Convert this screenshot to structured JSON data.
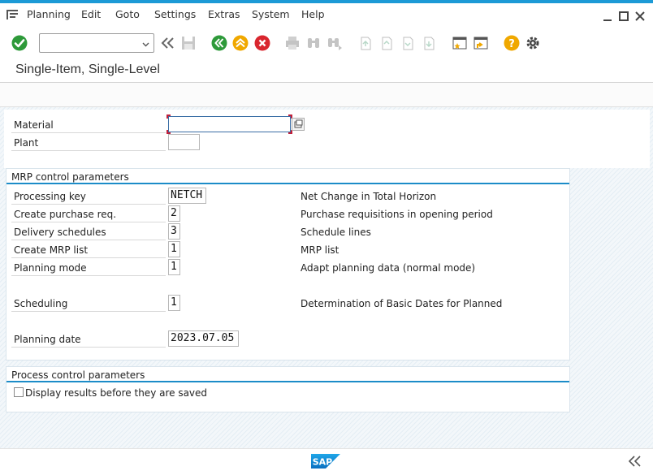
{
  "menu": {
    "items": [
      {
        "label": "Planning"
      },
      {
        "label": "Edit"
      },
      {
        "label": "Goto"
      },
      {
        "label": "Settings"
      },
      {
        "label": "Extras"
      },
      {
        "label": "System"
      },
      {
        "label": "Help"
      }
    ]
  },
  "toolbar": {
    "command_field_value": "",
    "icons": [
      "enter-check-icon",
      "back-double-chevron-icon",
      "save-icon",
      "back-green-icon",
      "exit-up-icon",
      "cancel-icon",
      "print-icon",
      "find-icon",
      "find-next-icon",
      "first-page-icon",
      "previous-page-icon",
      "next-page-icon",
      "last-page-icon",
      "create-session-icon",
      "create-shortcut-icon",
      "help-icon",
      "settings-gear-icon"
    ]
  },
  "page": {
    "title": "Single-Item, Single-Level"
  },
  "header_fields": {
    "material": {
      "label": "Material",
      "value": ""
    },
    "plant": {
      "label": "Plant",
      "value": ""
    }
  },
  "mrp_group": {
    "title": "MRP control parameters",
    "rows": [
      {
        "label": "Processing key",
        "value": "NETCH",
        "description": "Net Change in Total Horizon"
      },
      {
        "label": "Create purchase req.",
        "value": "2",
        "description": "Purchase requisitions in opening period"
      },
      {
        "label": "Delivery schedules",
        "value": "3",
        "description": "Schedule lines"
      },
      {
        "label": "Create MRP list",
        "value": "1",
        "description": "MRP list"
      },
      {
        "label": "Planning mode",
        "value": "1",
        "description": "Adapt planning data (normal mode)"
      },
      {
        "label": "Scheduling",
        "value": "1",
        "description": "Determination of Basic Dates for Planned"
      },
      {
        "label": "Planning date",
        "value": "2023.07.05",
        "description": ""
      }
    ]
  },
  "process_group": {
    "title": "Process control parameters",
    "checkbox_label": "Display results before they are saved",
    "checked": false
  },
  "footer": {
    "logo_text": "SAP"
  },
  "colors": {
    "accent_blue": "#1c9ad6",
    "group_line": "#1c8cc8",
    "green": "#2e9a3a",
    "orange": "#f0a800",
    "red": "#d9262e"
  }
}
